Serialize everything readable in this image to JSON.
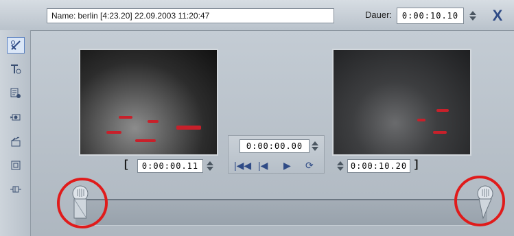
{
  "header": {
    "name_label": "Name:",
    "name_value": "berlin [4:23.20]  22.09.2003 11:20:47",
    "duration_label": "Dauer:",
    "duration_value": "0:00:10.10",
    "close_label": "X"
  },
  "sidebar": {
    "items": [
      {
        "icon": "scissors-edit-icon"
      },
      {
        "icon": "text-title-icon"
      },
      {
        "icon": "disc-menu-icon"
      },
      {
        "icon": "camera-audio-icon"
      },
      {
        "icon": "clapper-icon"
      },
      {
        "icon": "square-frame-icon"
      },
      {
        "icon": "plug-icon"
      }
    ]
  },
  "trim": {
    "in_time": "0:00:00.11",
    "out_time": "0:00:10.20",
    "current_time": "0:00:00.00",
    "in_bracket": "[",
    "out_bracket": "]"
  },
  "transport": {
    "buttons": [
      "go-to-start-icon",
      "step-back-icon",
      "play-icon",
      "loop-icon"
    ]
  },
  "colors": {
    "accent": "#2f4b86",
    "highlight_ring": "#e01b1b"
  }
}
